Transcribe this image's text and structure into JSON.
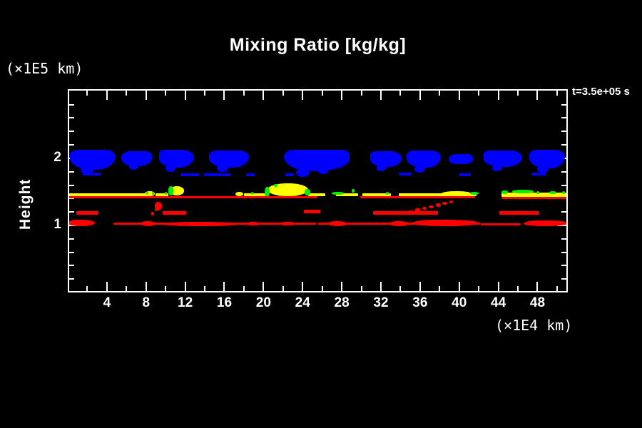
{
  "window": {
    "background": "#000000",
    "foreground": "#ffffff"
  },
  "title": "Mixing Ratio [kg/kg]",
  "timestamp": "t=3.5e+05 s",
  "axes": {
    "y_unit_label": "(×1E5 km)",
    "x_unit_label": "(×1E4 km)",
    "y_axis_label": "Height",
    "x_tick_labels": [
      "4",
      "8",
      "12",
      "16",
      "20",
      "24",
      "28",
      "32",
      "36",
      "40",
      "44",
      "48"
    ],
    "y_tick_labels": [
      "1",
      "2"
    ]
  },
  "chart_data": {
    "type": "heatmap",
    "title": "Mixing Ratio [kg/kg]",
    "xlabel": "(×1E4 km)",
    "ylabel": "Height (×1E5 km)",
    "xlim": [
      0,
      51.1
    ],
    "ylim": [
      0,
      3.03
    ],
    "grid": false,
    "legend": "none",
    "annotation": "t=3.5e+05 s",
    "x_major_ticks": [
      4,
      8,
      12,
      16,
      20,
      24,
      28,
      32,
      36,
      40,
      44,
      48
    ],
    "x_minor_ticks": [
      2,
      6,
      10,
      14,
      18,
      22,
      26,
      30,
      34,
      38,
      42,
      46,
      50
    ],
    "y_major_ticks": [
      1,
      2
    ],
    "y_minor_ticks": [
      0.2,
      0.4,
      0.6,
      0.8,
      1.2,
      1.4,
      1.6,
      1.8,
      2.2,
      2.4,
      2.6,
      2.8
    ],
    "colors": {
      "blue": "#0000ff",
      "yellow": "#ffff00",
      "green": "#00ee00",
      "red": "#ff0000",
      "axis": "#ffffff"
    },
    "features_format": "[x_left, y_top, width, height] in axis units (x: 1E4 km, y: 1E5 km)",
    "layers": [
      {
        "name": "upper-cloud-deck",
        "color": "#0000ff",
        "shape": "cloud",
        "note": "clumpy blue cloud band near height 1.8-2.1",
        "features": [
          [
            0.2,
            2.13,
            4.7,
            0.3
          ],
          [
            5.5,
            2.11,
            3.1,
            0.23
          ],
          [
            9.3,
            2.13,
            3.6,
            0.27
          ],
          [
            14.4,
            2.12,
            4.1,
            0.26
          ],
          [
            22.1,
            2.13,
            6.7,
            0.32
          ],
          [
            30.9,
            2.11,
            3.2,
            0.24
          ],
          [
            34.6,
            2.12,
            3.5,
            0.26
          ],
          [
            38.9,
            2.06,
            2.5,
            0.15
          ],
          [
            42.5,
            2.12,
            3.9,
            0.25
          ],
          [
            47.2,
            2.13,
            3.6,
            0.28
          ]
        ]
      },
      {
        "name": "cloud-bumps",
        "color": "#0000ff",
        "shape": "ellipse",
        "features": [
          [
            1.3,
            1.88,
            1.3,
            0.12
          ],
          [
            6.3,
            1.92,
            0.9,
            0.09
          ],
          [
            10.0,
            1.9,
            1.0,
            0.1
          ],
          [
            15.2,
            1.9,
            1.2,
            0.1
          ],
          [
            23.3,
            1.85,
            1.4,
            0.13
          ],
          [
            25.6,
            1.86,
            1.0,
            0.1
          ],
          [
            31.6,
            1.9,
            0.9,
            0.09
          ],
          [
            35.4,
            1.89,
            1.1,
            0.1
          ],
          [
            43.4,
            1.9,
            1.0,
            0.09
          ],
          [
            48.0,
            1.89,
            1.1,
            0.1
          ]
        ]
      },
      {
        "name": "cloud-wisps",
        "color": "#0000ff",
        "shape": "rect",
        "note": "thin detached blue streaks near height 1.75",
        "features": [
          [
            1.5,
            1.79,
            1.9,
            0.05
          ],
          [
            11.5,
            1.78,
            1.9,
            0.05
          ],
          [
            13.9,
            1.78,
            2.7,
            0.05
          ],
          [
            18.2,
            1.78,
            0.9,
            0.05
          ],
          [
            22.2,
            1.78,
            0.9,
            0.05
          ],
          [
            33.8,
            1.79,
            1.3,
            0.05
          ],
          [
            40.0,
            1.78,
            1.2,
            0.05
          ],
          [
            47.4,
            1.79,
            1.5,
            0.05
          ]
        ]
      },
      {
        "name": "yellow-layer-line",
        "color": "#ffff00",
        "shape": "rect",
        "note": "thin yellow layer near height 1.45",
        "features": [
          [
            0.0,
            1.475,
            8.2,
            0.045
          ],
          [
            9.0,
            1.475,
            1.3,
            0.045
          ],
          [
            18.0,
            1.475,
            2.2,
            0.045
          ],
          [
            24.6,
            1.475,
            1.7,
            0.045
          ],
          [
            27.4,
            1.475,
            2.3,
            0.045
          ],
          [
            30.1,
            1.475,
            2.9,
            0.045
          ],
          [
            33.8,
            1.475,
            8.0,
            0.045
          ],
          [
            44.3,
            1.49,
            6.8,
            0.07
          ]
        ]
      },
      {
        "name": "yellow-blobs",
        "color": "#ffff00",
        "shape": "ellipse",
        "features": [
          [
            7.9,
            1.51,
            1.0,
            0.08
          ],
          [
            10.4,
            1.58,
            1.5,
            0.13
          ],
          [
            17.1,
            1.5,
            0.8,
            0.07
          ],
          [
            20.4,
            1.63,
            4.2,
            0.2
          ],
          [
            38.1,
            1.51,
            3.2,
            0.09
          ]
        ]
      },
      {
        "name": "green-marks",
        "color": "#00ee00",
        "shape": "dot",
        "note": "green specks along the yellow layer",
        "features": [
          [
            8.0,
            1.5,
            0.25,
            0.045
          ],
          [
            8.6,
            1.5,
            0.25,
            0.045
          ],
          [
            9.9,
            1.5,
            0.25,
            0.045
          ],
          [
            10.3,
            1.58,
            0.5,
            0.13
          ],
          [
            18.7,
            1.5,
            0.25,
            0.045
          ],
          [
            20.1,
            1.57,
            0.5,
            0.15
          ],
          [
            21.1,
            1.62,
            0.3,
            0.05
          ],
          [
            24.2,
            1.54,
            0.55,
            0.09
          ],
          [
            21.6,
            1.45,
            0.3,
            0.04
          ],
          [
            23.1,
            1.45,
            0.3,
            0.04
          ],
          [
            27.0,
            1.5,
            1.2,
            0.045
          ],
          [
            29.0,
            1.54,
            0.3,
            0.05
          ],
          [
            32.5,
            1.5,
            0.3,
            0.045
          ],
          [
            41.1,
            1.5,
            0.9,
            0.045
          ],
          [
            44.3,
            1.52,
            0.7,
            0.05
          ],
          [
            45.4,
            1.53,
            2.2,
            0.05
          ],
          [
            47.9,
            1.51,
            0.3,
            0.045
          ],
          [
            49.2,
            1.51,
            0.7,
            0.045
          ],
          [
            50.5,
            1.51,
            0.3,
            0.045
          ]
        ]
      },
      {
        "name": "red-underline",
        "color": "#ff0000",
        "shape": "rect",
        "note": "thin red line just below yellow layer",
        "features": [
          [
            0.0,
            1.43,
            25.5,
            0.03
          ],
          [
            29.9,
            1.43,
            11.7,
            0.03
          ],
          [
            44.3,
            1.42,
            6.8,
            0.03
          ]
        ]
      },
      {
        "name": "red-mid-segments",
        "color": "#ff0000",
        "shape": "rect",
        "note": "red segments near height 1.2",
        "features": [
          [
            0.9,
            1.21,
            2.2,
            0.055
          ],
          [
            9.7,
            1.21,
            2.4,
            0.055
          ],
          [
            24.1,
            1.23,
            1.7,
            0.05
          ],
          [
            31.2,
            1.21,
            6.6,
            0.055
          ],
          [
            44.1,
            1.21,
            4.1,
            0.055
          ]
        ]
      },
      {
        "name": "red-dots",
        "color": "#ff0000",
        "shape": "dot",
        "note": "diagonal chains of red specks",
        "features": [
          [
            8.55,
            1.2,
            0.3,
            0.05
          ],
          [
            8.9,
            1.26,
            0.3,
            0.05
          ],
          [
            8.9,
            1.35,
            0.75,
            0.13
          ],
          [
            34.8,
            1.225,
            0.5,
            0.045
          ],
          [
            35.5,
            1.25,
            0.5,
            0.045
          ],
          [
            36.2,
            1.275,
            0.5,
            0.045
          ],
          [
            36.9,
            1.3,
            0.5,
            0.045
          ],
          [
            37.6,
            1.325,
            0.5,
            0.045
          ],
          [
            38.3,
            1.35,
            0.5,
            0.045
          ],
          [
            39.0,
            1.37,
            0.4,
            0.045
          ]
        ]
      },
      {
        "name": "red-bottom-line",
        "color": "#ff0000",
        "shape": "rect",
        "note": "thin red base layer near height 1.0",
        "features": [
          [
            4.7,
            1.045,
            20.7,
            0.04
          ],
          [
            25.6,
            1.045,
            16.5,
            0.04
          ],
          [
            42.2,
            1.035,
            4.1,
            0.035
          ]
        ]
      },
      {
        "name": "red-bottom-thick",
        "color": "#ff0000",
        "shape": "lump",
        "features": [
          [
            0.0,
            1.085,
            2.8,
            0.1
          ],
          [
            7.4,
            1.06,
            1.6,
            0.07
          ],
          [
            9.7,
            1.055,
            7.9,
            0.065
          ],
          [
            18.3,
            1.055,
            1.3,
            0.06
          ],
          [
            21.7,
            1.055,
            1.6,
            0.06
          ],
          [
            26.6,
            1.06,
            2.0,
            0.07
          ],
          [
            32.9,
            1.06,
            2.0,
            0.07
          ],
          [
            35.1,
            1.085,
            6.9,
            0.1
          ],
          [
            46.6,
            1.075,
            4.6,
            0.09
          ]
        ]
      }
    ]
  }
}
